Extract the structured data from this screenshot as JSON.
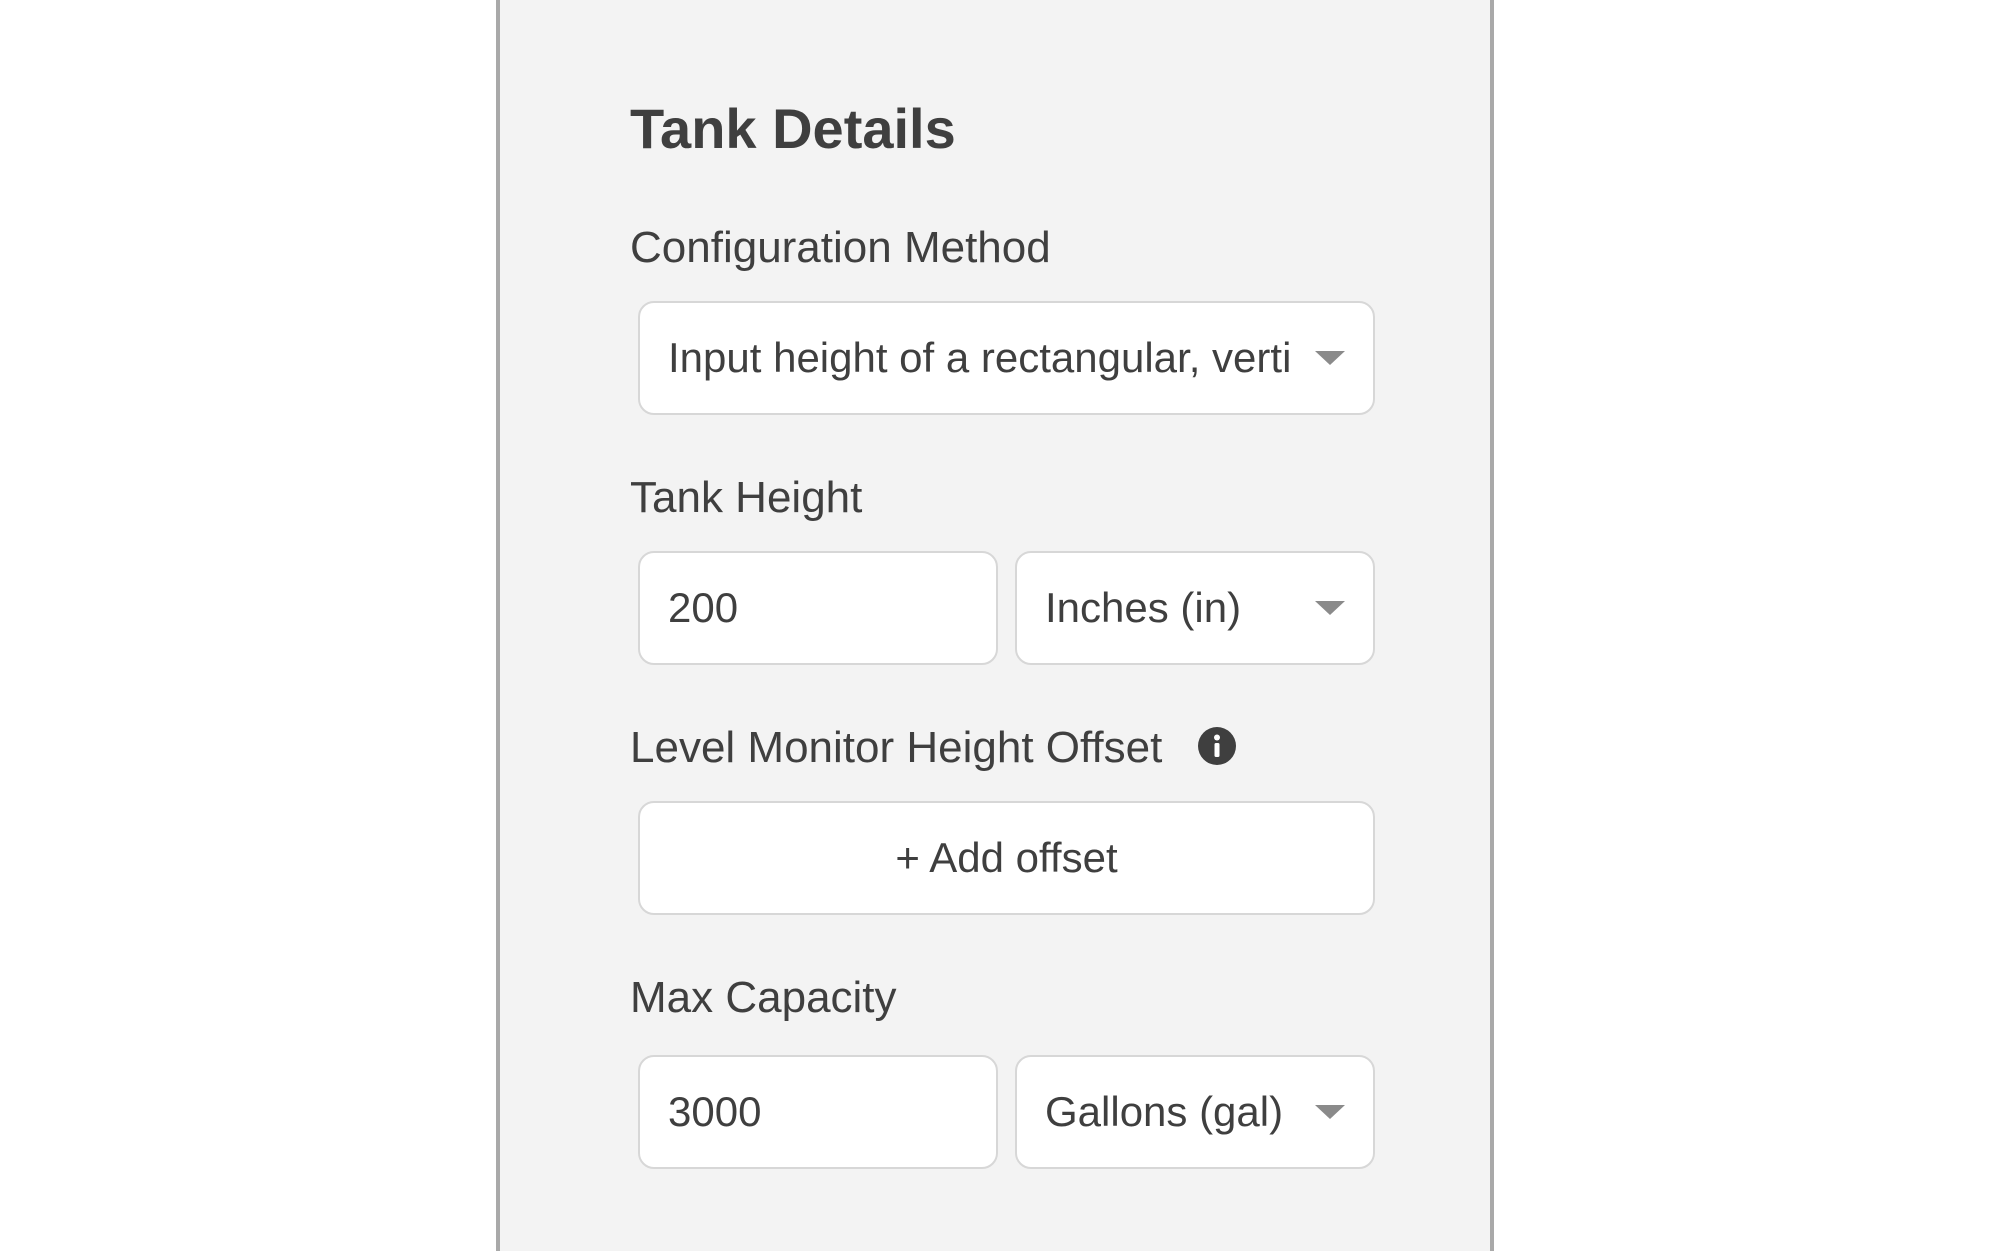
{
  "section": {
    "title": "Tank Details"
  },
  "configuration_method": {
    "label": "Configuration Method",
    "value": "Input height of a rectangular, verti"
  },
  "tank_height": {
    "label": "Tank Height",
    "value": "200",
    "unit": "Inches (in)"
  },
  "offset": {
    "label": "Level Monitor Height Offset",
    "info_icon": "info-icon",
    "button_label": "+ Add offset"
  },
  "max_capacity": {
    "label": "Max Capacity",
    "value": "3000",
    "unit": "Gallons (gal)"
  },
  "colors": {
    "panel_background": "#f3f3f3",
    "panel_border": "#a9a9a9",
    "text": "#3f3f3f",
    "field_border": "#d7d7d7",
    "caret": "#8a8a8a"
  }
}
